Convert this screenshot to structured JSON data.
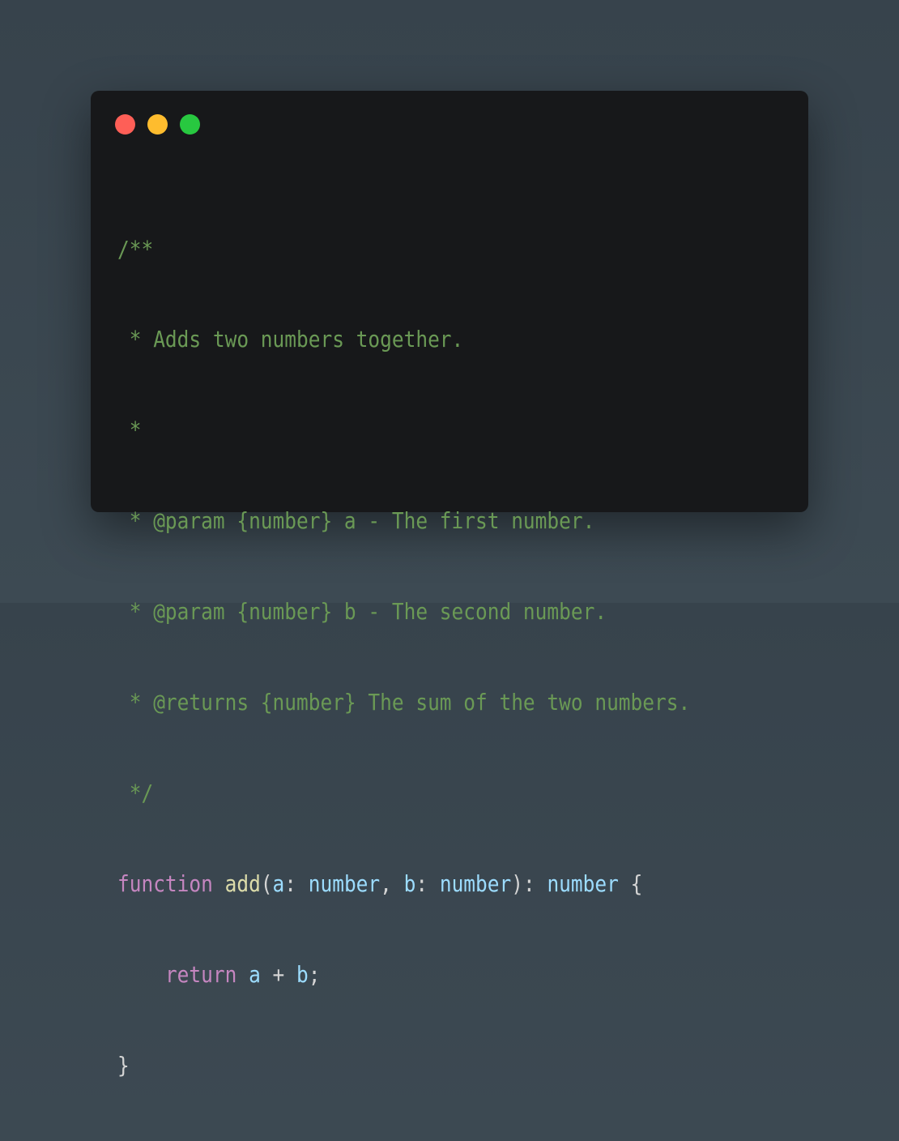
{
  "window": {
    "controls": {
      "close_color": "#fe5f57",
      "minimize_color": "#febc2e",
      "maximize_color": "#28c840"
    }
  },
  "code": {
    "language": "typescript",
    "lines": {
      "l1": "/**",
      "l2": " * Adds two numbers together.",
      "l3": " *",
      "l4": " * @param {number} a - The first number.",
      "l5": " * @param {number} b - The second number.",
      "l6": " * @returns {number} The sum of the two numbers.",
      "l7": " */",
      "l8_kw": "function",
      "l8_fn": "add",
      "l8_p1": "(",
      "l8_a": "a",
      "l8_c1": ": ",
      "l8_t1": "number",
      "l8_comma": ", ",
      "l8_b": "b",
      "l8_c2": ": ",
      "l8_t2": "number",
      "l8_p2": "): ",
      "l8_t3": "number",
      "l8_brace": " {",
      "l9_indent": "    ",
      "l9_kw": "return",
      "l9_a": "a",
      "l9_plus": " + ",
      "l9_b": "b",
      "l9_semi": ";",
      "l10": "}"
    }
  }
}
